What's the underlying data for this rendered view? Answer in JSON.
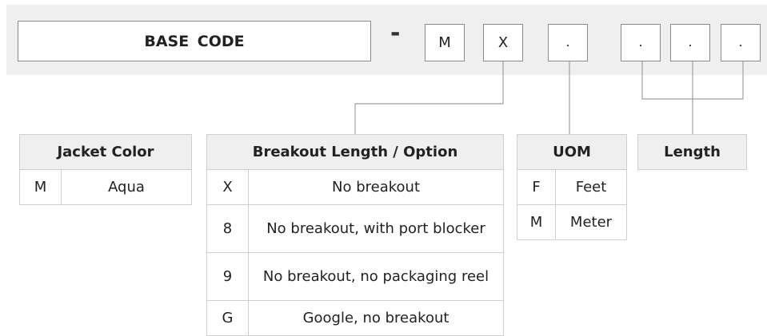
{
  "code": {
    "base": "BASE  CODE",
    "dash": "-",
    "segments": [
      "M",
      "X",
      ".",
      ".",
      ".",
      "."
    ]
  },
  "jacket_color": {
    "title": "Jacket Color",
    "rows": [
      {
        "code": "M",
        "value": "Aqua"
      }
    ]
  },
  "breakout": {
    "title": "Breakout Length / Option",
    "rows": [
      {
        "code": "X",
        "value": "No breakout"
      },
      {
        "code": "8",
        "value": "No breakout, with port blocker"
      },
      {
        "code": "9",
        "value": "No breakout, no packaging reel"
      },
      {
        "code": "G",
        "value": "Google, no breakout"
      }
    ]
  },
  "uom": {
    "title": "UOM",
    "rows": [
      {
        "code": "F",
        "value": "Feet"
      },
      {
        "code": "M",
        "value": "Meter"
      }
    ]
  },
  "length": {
    "title": "Length"
  },
  "colors": {
    "band": "#efefef",
    "header": "#efefef",
    "box_border": "#8a8a8a",
    "table_border": "#cfcfcf",
    "connector": "#a0a0a0"
  }
}
